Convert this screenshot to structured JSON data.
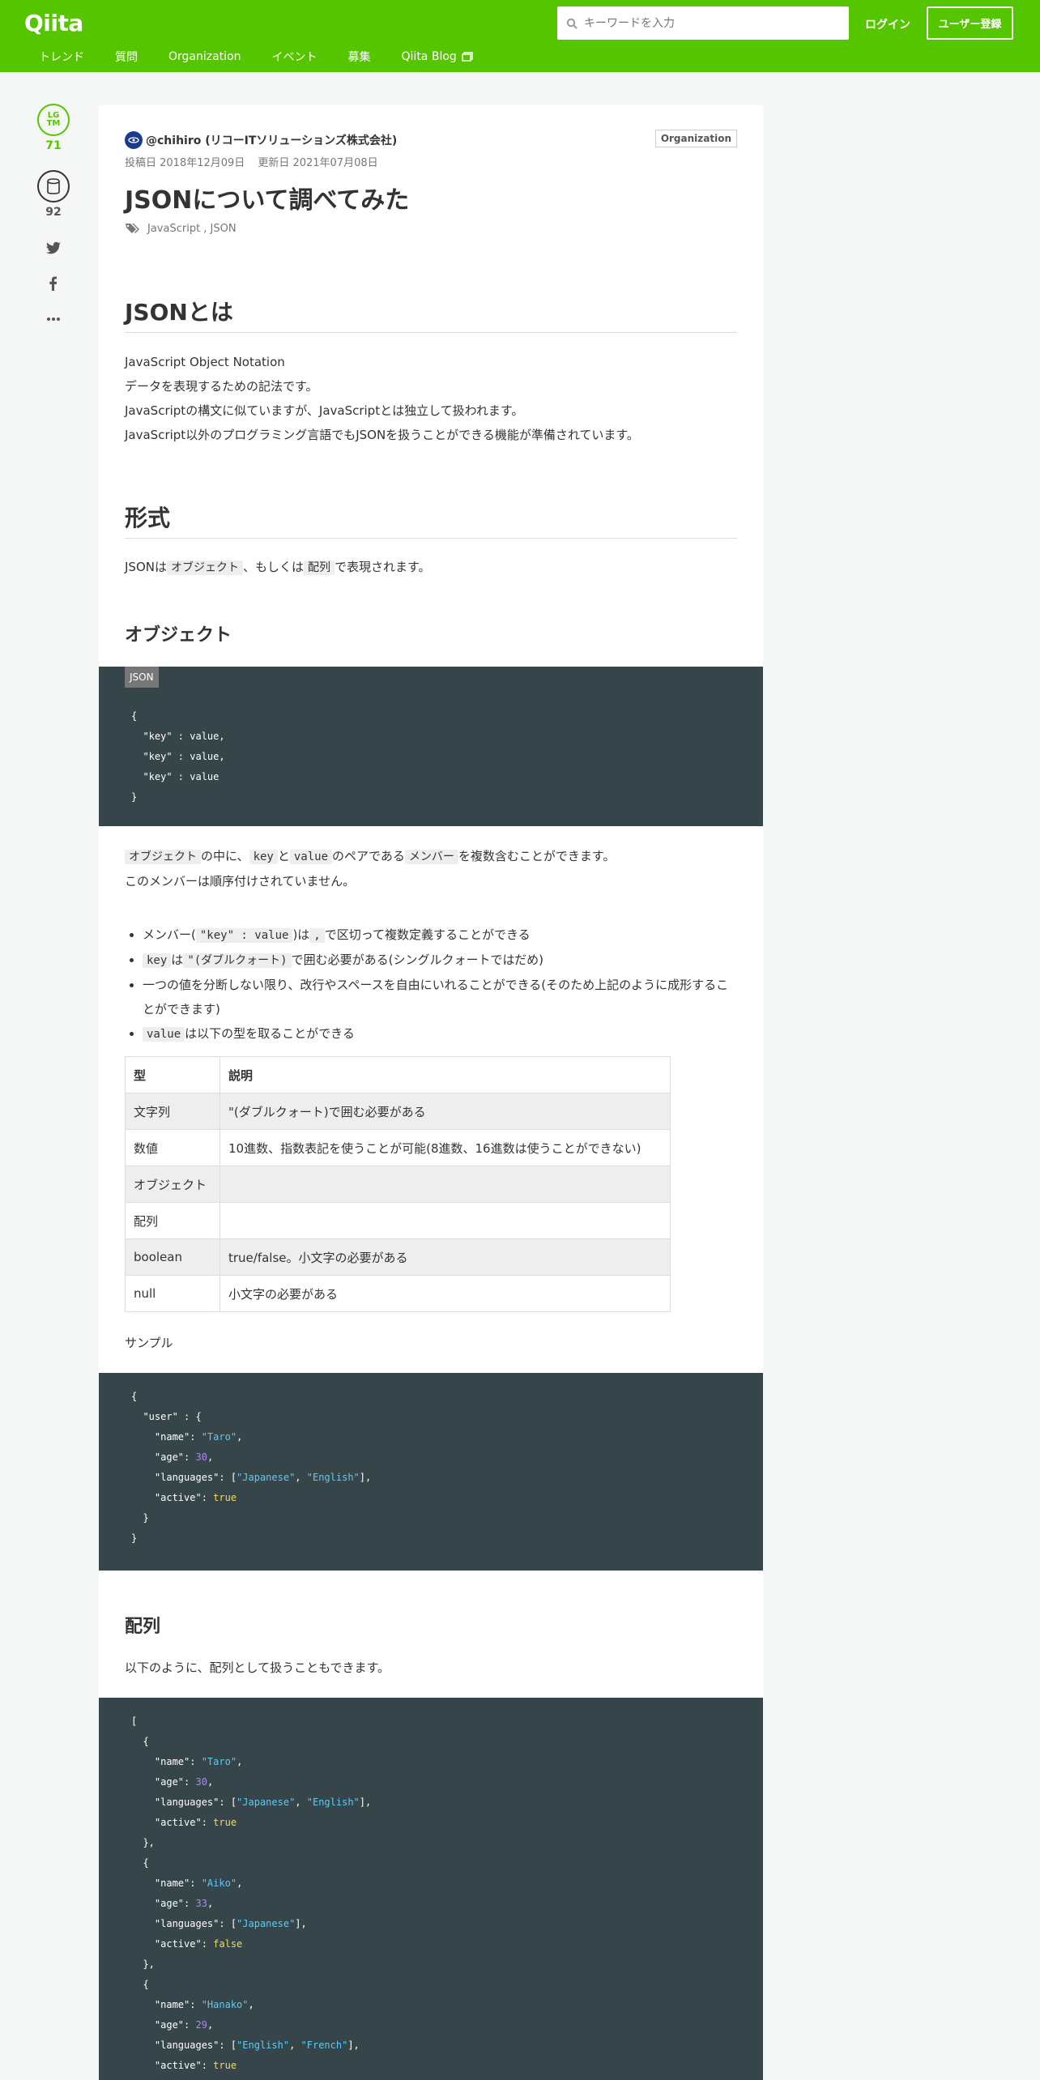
{
  "header": {
    "logo": "Qiita",
    "search_placeholder": "キーワードを入力",
    "login": "ログイン",
    "signup": "ユーザー登録",
    "nav": [
      "トレンド",
      "質問",
      "Organization",
      "イベント",
      "募集",
      "Qiita Blog"
    ]
  },
  "rail": {
    "lgtm_icon": "LG\nTM",
    "lgtm_count": "71",
    "stock_count": "92",
    "share_icons": [
      "twitter-icon",
      "facebook-icon",
      "more-icon"
    ]
  },
  "article": {
    "author": "@chihiro (リコーITソリューションズ株式会社)",
    "org_badge": "Organization",
    "posted": "投稿日 2018年12月09日",
    "updated": "更新日 2021年07月08日",
    "title": "JSONについて調べてみた",
    "tags": "JavaScript , JSON",
    "sections": {
      "json_h2": "JSONとは",
      "json_lines": [
        "JavaScript Object Notation",
        "データを表現するための記法です。",
        "JavaScriptの構文に似ていますが、JavaScriptとは独立して扱われます。",
        "JavaScript以外のプログラミング言語でもJSONを扱うことができる機能が準備されています。"
      ],
      "format_h2": "形式",
      "format_pre": "JSONは",
      "format_code1": "オブジェクト",
      "format_mid": "、もしくは",
      "format_code2": "配列",
      "format_post": "で表現されます。",
      "object_h3": "オブジェクト",
      "code1_label": "JSON",
      "code1_lines": [
        "{",
        "  \"key\" : value,",
        "  \"key\" : value,",
        "  \"key\" : value",
        "}"
      ],
      "obj_p1_code1": "オブジェクト",
      "obj_p1_t1": "の中に、",
      "obj_p1_code2": "key",
      "obj_p1_t2": "と",
      "obj_p1_code3": "value",
      "obj_p1_t3": "のペアである",
      "obj_p1_code4": "メンバー",
      "obj_p1_t4": "を複数含むことができます。",
      "obj_p2": "このメンバーは順序付けされていません。",
      "bullets": {
        "b1_pre": "メンバー(",
        "b1_code1": "\"key\" : value",
        "b1_mid": ")は",
        "b1_code2": ",",
        "b1_post": "で区切って複数定義することができる",
        "b2_code1": "key",
        "b2_t1": "は",
        "b2_code2": "\"(ダブルクォート)",
        "b2_post": "で囲む必要がある(シングルクォートではだめ)",
        "b3": "一つの値を分断しない限り、改行やスペースを自由にいれることができる(そのため上記のように成形することができます)",
        "b4_code": "value",
        "b4_post": "は以下の型を取ることができる"
      },
      "table": {
        "headers": [
          "型",
          "説明"
        ],
        "rows": [
          [
            "文字列",
            "\"(ダブルクォート)で囲む必要がある"
          ],
          [
            "数値",
            "10進数、指数表記を使うことが可能(8進数、16進数は使うことができない)"
          ],
          [
            "オブジェクト",
            ""
          ],
          [
            "配列",
            ""
          ],
          [
            "boolean",
            "true/false。小文字の必要がある"
          ],
          [
            "null",
            "小文字の必要がある"
          ]
        ]
      },
      "sample_label": "サンプル",
      "array_h3": "配列",
      "array_p": "以下のように、配列として扱うこともできます。"
    }
  }
}
